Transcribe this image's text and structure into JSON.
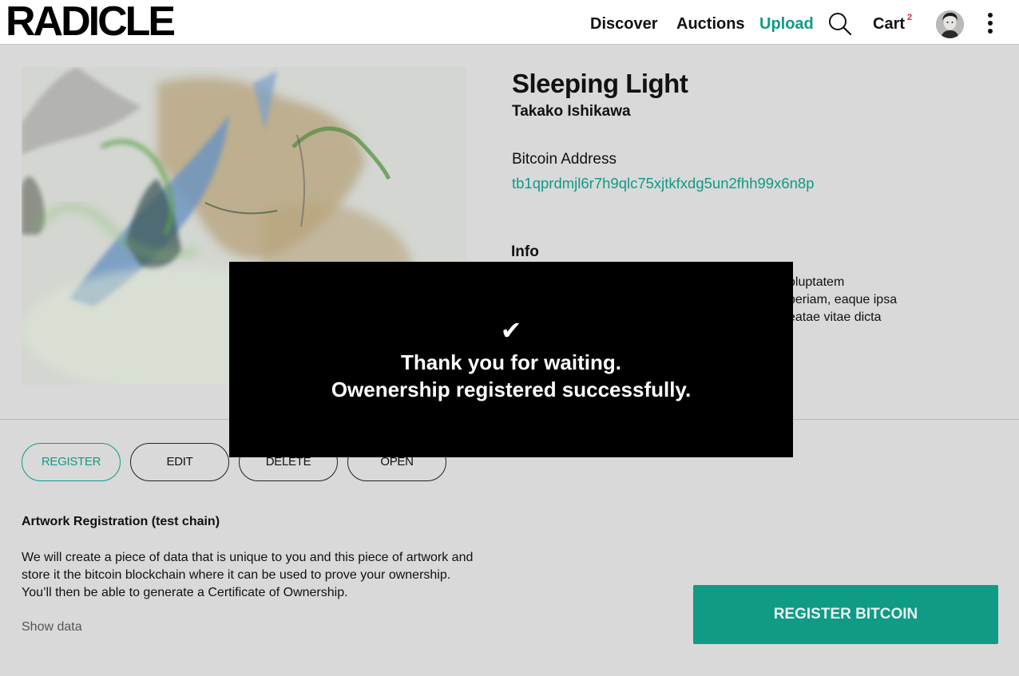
{
  "header": {
    "logo": "RADICLE",
    "nav": {
      "discover": "Discover",
      "auctions": "Auctions",
      "upload": "Upload",
      "cart": "Cart",
      "cart_count": "2"
    },
    "icons": [
      "search-icon",
      "avatar",
      "kebab-menu-icon"
    ]
  },
  "artwork": {
    "title": "Sleeping Light",
    "artist": "Takako Ishikawa",
    "bitcoin_label": "Bitcoin Address",
    "bitcoin_address": "tb1qprdmjl6r7h9qlc75xjtkfxdg5un2fhh99x6n8p",
    "info_heading": "Info",
    "info_lines": [
      "oluptatem",
      "periam, eaque ipsa",
      "eatae vitae dicta"
    ]
  },
  "actions": {
    "register": "REGISTER",
    "edit": "EDIT",
    "delete": "DELETE",
    "open": "OPEN"
  },
  "registration": {
    "heading": "Artwork Registration (test chain)",
    "lines": [
      "We will create a piece of data that is unique to you and this piece of artwork and",
      "store it the bitcoin blockchain where it can be used to prove your ownership.",
      "You’ll then be able to generate a Certificate of Ownership."
    ],
    "show_data": "Show data",
    "cta": "REGISTER BITCOIN"
  },
  "modal": {
    "check": "✔",
    "line1": "Thank you for waiting.",
    "line2": "Owenership registered successfully."
  },
  "colors": {
    "accent": "#0f9b85",
    "badge": "#e0243b",
    "background": "#d9d9d9",
    "modal": "#000000"
  }
}
